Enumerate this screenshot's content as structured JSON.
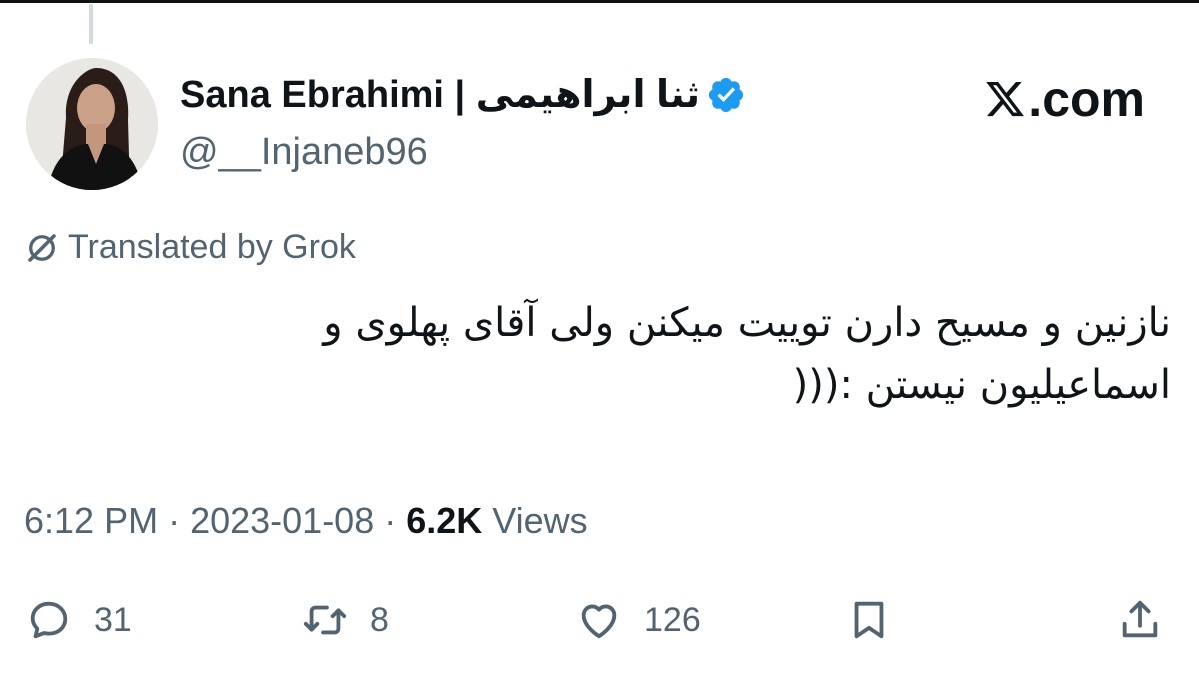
{
  "author": {
    "display_name": "Sana Ebrahimi | ثنا ابراهیمی",
    "handle": "@__Injaneb96",
    "verified_color": "#1d9bf0"
  },
  "brand": {
    "domain_text": ".com",
    "icon": "x-logo-icon"
  },
  "translation": {
    "label": "Translated by Grok",
    "icon": "grok-icon"
  },
  "tweet": {
    "text": "نازنین و مسیح دارن توییت میکنن ولی آقای پهلوی و اسماعیلیون نیستن :((("
  },
  "meta": {
    "time": "6:12 PM",
    "separator": " · ",
    "date": "2023-01-08",
    "views_count": "6.2K",
    "views_label": "Views"
  },
  "actions": {
    "replies": "31",
    "reposts": "8",
    "likes": "126"
  },
  "colors": {
    "text_primary": "#0f1419",
    "text_secondary": "#536471",
    "accent": "#1d9bf0"
  }
}
